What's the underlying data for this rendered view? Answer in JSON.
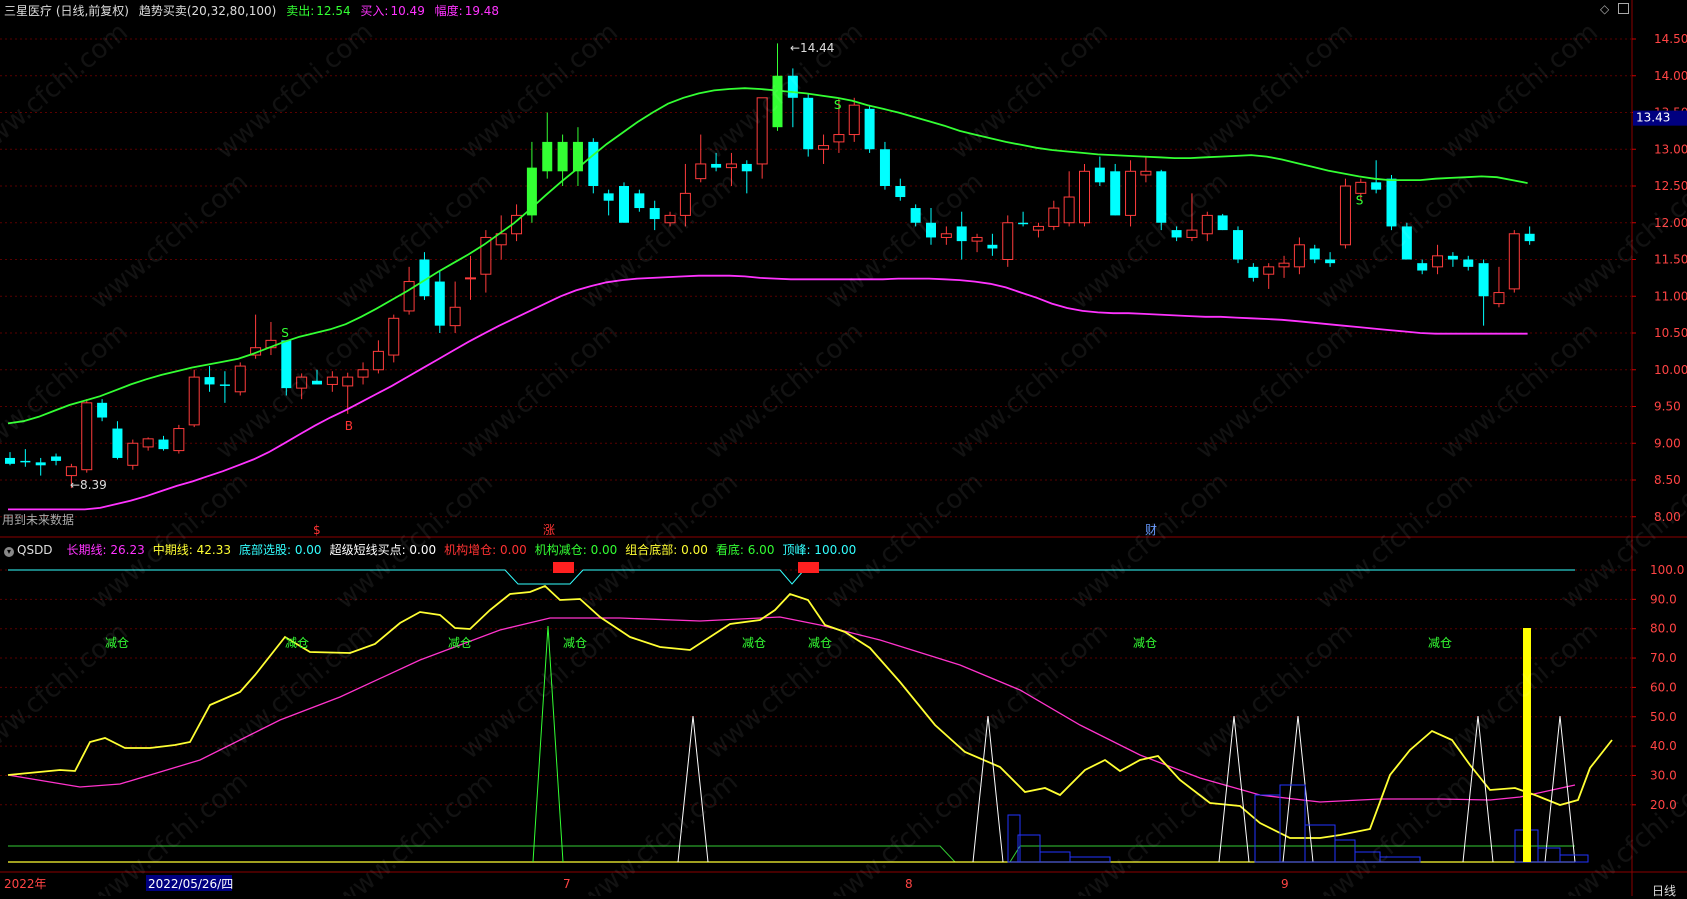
{
  "header": {
    "stock": "三星医疗 (日线,前复权)",
    "indicator": "趋势买卖(20,32,80,100)",
    "sell_label": "卖出:",
    "sell_value": "12.54",
    "buy_label": "买入:",
    "buy_value": "10.49",
    "amp_label": "幅度:",
    "amp_value": "19.48"
  },
  "main_chart": {
    "price_ticks": [
      "14.50",
      "14.00",
      "13.50",
      "13.00",
      "12.50",
      "12.00",
      "11.50",
      "11.00",
      "10.50",
      "10.00",
      "9.50",
      "9.00",
      "8.50",
      "8.00"
    ],
    "current_price": "13.43",
    "high_label": "14.44",
    "low_label": "8.39",
    "future_note": "用到未来数据",
    "markers": [
      "$",
      "涨",
      "财"
    ],
    "signal_b": "B",
    "signal_s": "S"
  },
  "sub_chart": {
    "name": "QSDD",
    "legend": [
      {
        "label": "长期线: 26.23",
        "color": "#ff33ff"
      },
      {
        "label": "中期线: 42.33",
        "color": "#ffff33"
      },
      {
        "label": "底部选股: 0.00",
        "color": "#33ffff"
      },
      {
        "label": "超级短线买点: 0.00",
        "color": "#ffffff"
      },
      {
        "label": "机构增仓: 0.00",
        "color": "#ff3333"
      },
      {
        "label": "机构减仓: 0.00",
        "color": "#33ff33"
      },
      {
        "label": "组合底部: 0.00",
        "color": "#ffff33"
      },
      {
        "label": "看底: 6.00",
        "color": "#33ff33"
      },
      {
        "label": "顶峰: 100.00",
        "color": "#33ffff"
      }
    ],
    "ticks": [
      "100.0",
      "90.0",
      "80.0",
      "70.0",
      "60.0",
      "50.0",
      "40.0",
      "30.0",
      "20.0"
    ],
    "reduce_label": "减仓"
  },
  "time_axis": {
    "labels": [
      "2022年",
      "2022/05/26/四",
      "7",
      "8",
      "9"
    ],
    "period": "日线"
  },
  "colors": {
    "up": "#ff3c3c",
    "down": "#00ffff",
    "upper_band": "#33ff33",
    "lower_band": "#ff33ff",
    "grid": "#5a0000"
  }
}
